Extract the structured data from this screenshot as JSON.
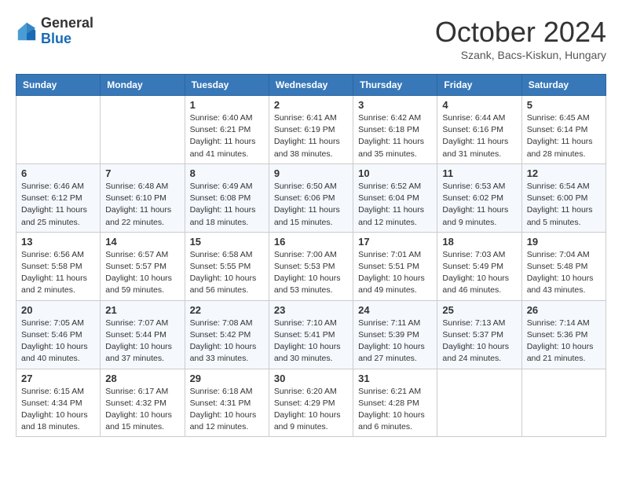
{
  "header": {
    "logo": {
      "general": "General",
      "blue": "Blue"
    },
    "title": "October 2024",
    "subtitle": "Szank, Bacs-Kiskun, Hungary"
  },
  "calendar": {
    "days_of_week": [
      "Sunday",
      "Monday",
      "Tuesday",
      "Wednesday",
      "Thursday",
      "Friday",
      "Saturday"
    ],
    "weeks": [
      [
        {
          "day": "",
          "info": ""
        },
        {
          "day": "",
          "info": ""
        },
        {
          "day": "1",
          "info": "Sunrise: 6:40 AM\nSunset: 6:21 PM\nDaylight: 11 hours and 41 minutes."
        },
        {
          "day": "2",
          "info": "Sunrise: 6:41 AM\nSunset: 6:19 PM\nDaylight: 11 hours and 38 minutes."
        },
        {
          "day": "3",
          "info": "Sunrise: 6:42 AM\nSunset: 6:18 PM\nDaylight: 11 hours and 35 minutes."
        },
        {
          "day": "4",
          "info": "Sunrise: 6:44 AM\nSunset: 6:16 PM\nDaylight: 11 hours and 31 minutes."
        },
        {
          "day": "5",
          "info": "Sunrise: 6:45 AM\nSunset: 6:14 PM\nDaylight: 11 hours and 28 minutes."
        }
      ],
      [
        {
          "day": "6",
          "info": "Sunrise: 6:46 AM\nSunset: 6:12 PM\nDaylight: 11 hours and 25 minutes."
        },
        {
          "day": "7",
          "info": "Sunrise: 6:48 AM\nSunset: 6:10 PM\nDaylight: 11 hours and 22 minutes."
        },
        {
          "day": "8",
          "info": "Sunrise: 6:49 AM\nSunset: 6:08 PM\nDaylight: 11 hours and 18 minutes."
        },
        {
          "day": "9",
          "info": "Sunrise: 6:50 AM\nSunset: 6:06 PM\nDaylight: 11 hours and 15 minutes."
        },
        {
          "day": "10",
          "info": "Sunrise: 6:52 AM\nSunset: 6:04 PM\nDaylight: 11 hours and 12 minutes."
        },
        {
          "day": "11",
          "info": "Sunrise: 6:53 AM\nSunset: 6:02 PM\nDaylight: 11 hours and 9 minutes."
        },
        {
          "day": "12",
          "info": "Sunrise: 6:54 AM\nSunset: 6:00 PM\nDaylight: 11 hours and 5 minutes."
        }
      ],
      [
        {
          "day": "13",
          "info": "Sunrise: 6:56 AM\nSunset: 5:58 PM\nDaylight: 11 hours and 2 minutes."
        },
        {
          "day": "14",
          "info": "Sunrise: 6:57 AM\nSunset: 5:57 PM\nDaylight: 10 hours and 59 minutes."
        },
        {
          "day": "15",
          "info": "Sunrise: 6:58 AM\nSunset: 5:55 PM\nDaylight: 10 hours and 56 minutes."
        },
        {
          "day": "16",
          "info": "Sunrise: 7:00 AM\nSunset: 5:53 PM\nDaylight: 10 hours and 53 minutes."
        },
        {
          "day": "17",
          "info": "Sunrise: 7:01 AM\nSunset: 5:51 PM\nDaylight: 10 hours and 49 minutes."
        },
        {
          "day": "18",
          "info": "Sunrise: 7:03 AM\nSunset: 5:49 PM\nDaylight: 10 hours and 46 minutes."
        },
        {
          "day": "19",
          "info": "Sunrise: 7:04 AM\nSunset: 5:48 PM\nDaylight: 10 hours and 43 minutes."
        }
      ],
      [
        {
          "day": "20",
          "info": "Sunrise: 7:05 AM\nSunset: 5:46 PM\nDaylight: 10 hours and 40 minutes."
        },
        {
          "day": "21",
          "info": "Sunrise: 7:07 AM\nSunset: 5:44 PM\nDaylight: 10 hours and 37 minutes."
        },
        {
          "day": "22",
          "info": "Sunrise: 7:08 AM\nSunset: 5:42 PM\nDaylight: 10 hours and 33 minutes."
        },
        {
          "day": "23",
          "info": "Sunrise: 7:10 AM\nSunset: 5:41 PM\nDaylight: 10 hours and 30 minutes."
        },
        {
          "day": "24",
          "info": "Sunrise: 7:11 AM\nSunset: 5:39 PM\nDaylight: 10 hours and 27 minutes."
        },
        {
          "day": "25",
          "info": "Sunrise: 7:13 AM\nSunset: 5:37 PM\nDaylight: 10 hours and 24 minutes."
        },
        {
          "day": "26",
          "info": "Sunrise: 7:14 AM\nSunset: 5:36 PM\nDaylight: 10 hours and 21 minutes."
        }
      ],
      [
        {
          "day": "27",
          "info": "Sunrise: 6:15 AM\nSunset: 4:34 PM\nDaylight: 10 hours and 18 minutes."
        },
        {
          "day": "28",
          "info": "Sunrise: 6:17 AM\nSunset: 4:32 PM\nDaylight: 10 hours and 15 minutes."
        },
        {
          "day": "29",
          "info": "Sunrise: 6:18 AM\nSunset: 4:31 PM\nDaylight: 10 hours and 12 minutes."
        },
        {
          "day": "30",
          "info": "Sunrise: 6:20 AM\nSunset: 4:29 PM\nDaylight: 10 hours and 9 minutes."
        },
        {
          "day": "31",
          "info": "Sunrise: 6:21 AM\nSunset: 4:28 PM\nDaylight: 10 hours and 6 minutes."
        },
        {
          "day": "",
          "info": ""
        },
        {
          "day": "",
          "info": ""
        }
      ]
    ]
  }
}
